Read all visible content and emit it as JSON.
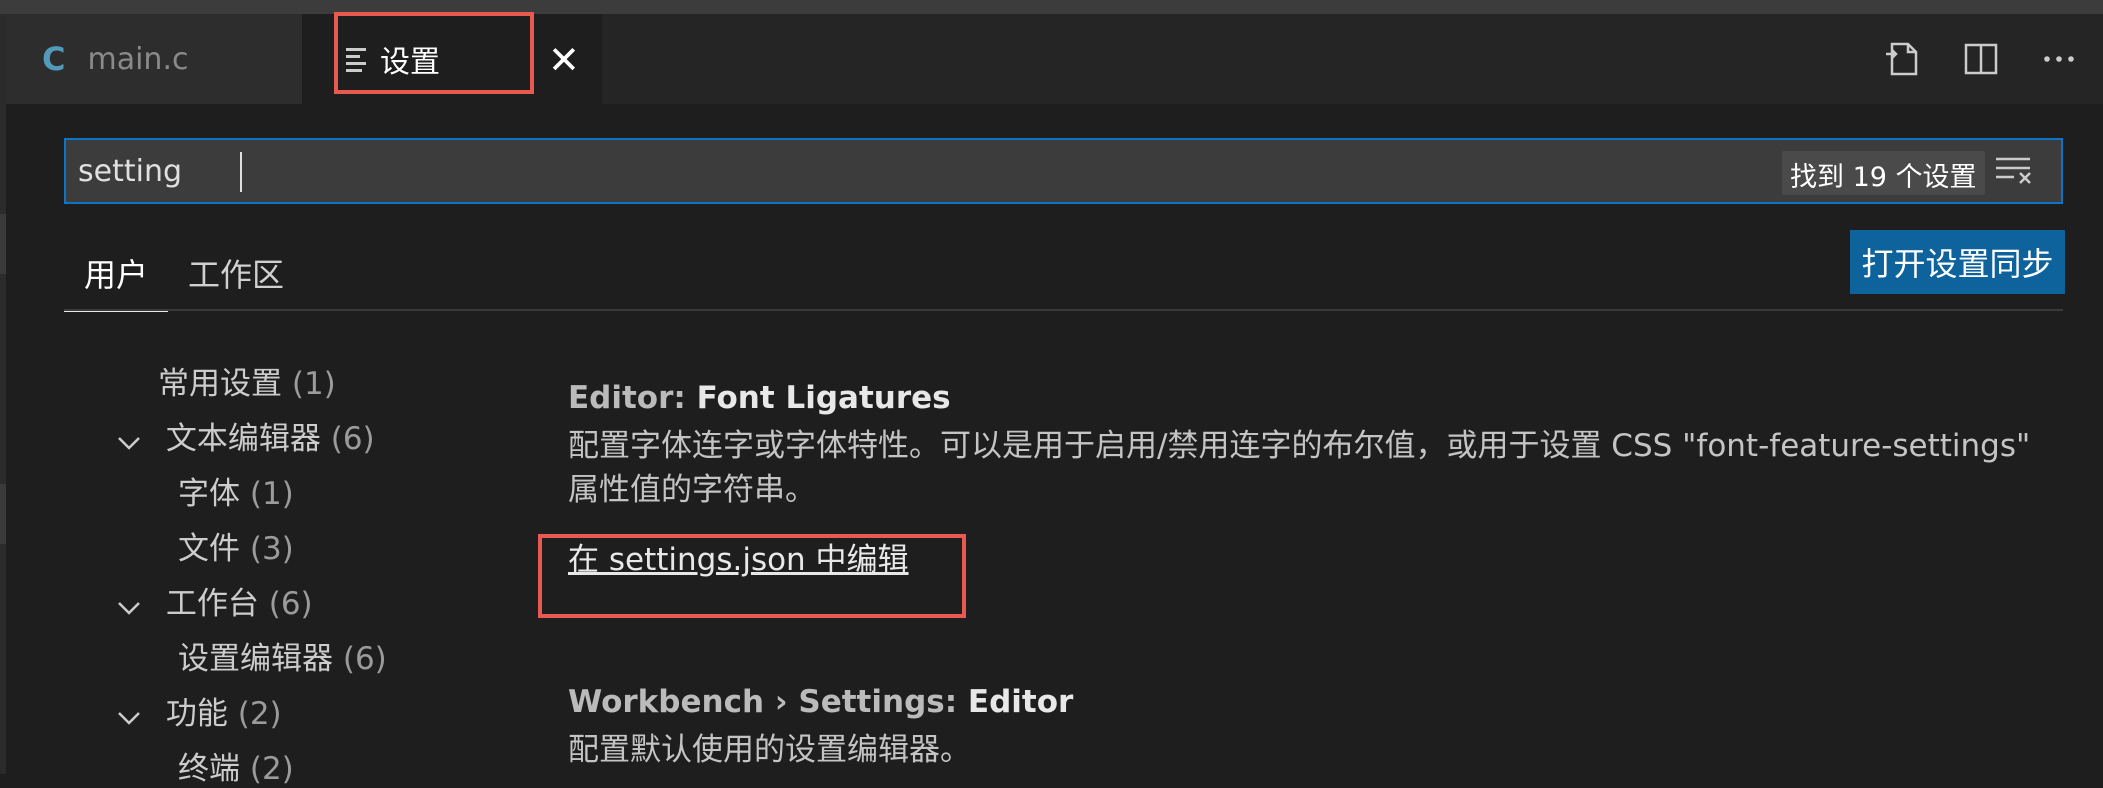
{
  "tabs": [
    {
      "label": "main.c",
      "icon": "c-language-icon",
      "active": false
    },
    {
      "label": "设置",
      "icon": "settings-lines-icon",
      "active": true
    }
  ],
  "tab_close_glyph": "✕",
  "editor_actions": [
    "open-settings-json-icon",
    "split-editor-icon",
    "more-actions-icon"
  ],
  "search": {
    "value": "setting",
    "result_count": "找到 19 个设置"
  },
  "scope_tabs": [
    "用户",
    "工作区"
  ],
  "sync_button": "打开设置同步",
  "toc": [
    {
      "label": "常用设置",
      "count": "(1)",
      "level": 0,
      "expandable": false
    },
    {
      "label": "文本编辑器",
      "count": "(6)",
      "level": 0,
      "expandable": true
    },
    {
      "label": "字体",
      "count": "(1)",
      "level": 1,
      "expandable": false
    },
    {
      "label": "文件",
      "count": "(3)",
      "level": 1,
      "expandable": false
    },
    {
      "label": "工作台",
      "count": "(6)",
      "level": 0,
      "expandable": true
    },
    {
      "label": "设置编辑器",
      "count": "(6)",
      "level": 1,
      "expandable": false
    },
    {
      "label": "功能",
      "count": "(2)",
      "level": 0,
      "expandable": true
    },
    {
      "label": "终端",
      "count": "(2)",
      "level": 1,
      "expandable": false
    }
  ],
  "settings": [
    {
      "category": "Editor: ",
      "name": "Font Ligatures",
      "description": "配置字体连字或字体特性。可以是用于启用/禁用连字的布尔值，或用于设置 CSS \"font-feature-settings\" 属性值的字符串。",
      "link": "在 settings.json 中编辑"
    },
    {
      "category": "Workbench › Settings: ",
      "name": "Editor",
      "description": "配置默认使用的设置编辑器。"
    }
  ],
  "colors": {
    "accent": "#0e639c",
    "focus_border": "#0e74c6",
    "highlight_box": "#e8594f"
  }
}
